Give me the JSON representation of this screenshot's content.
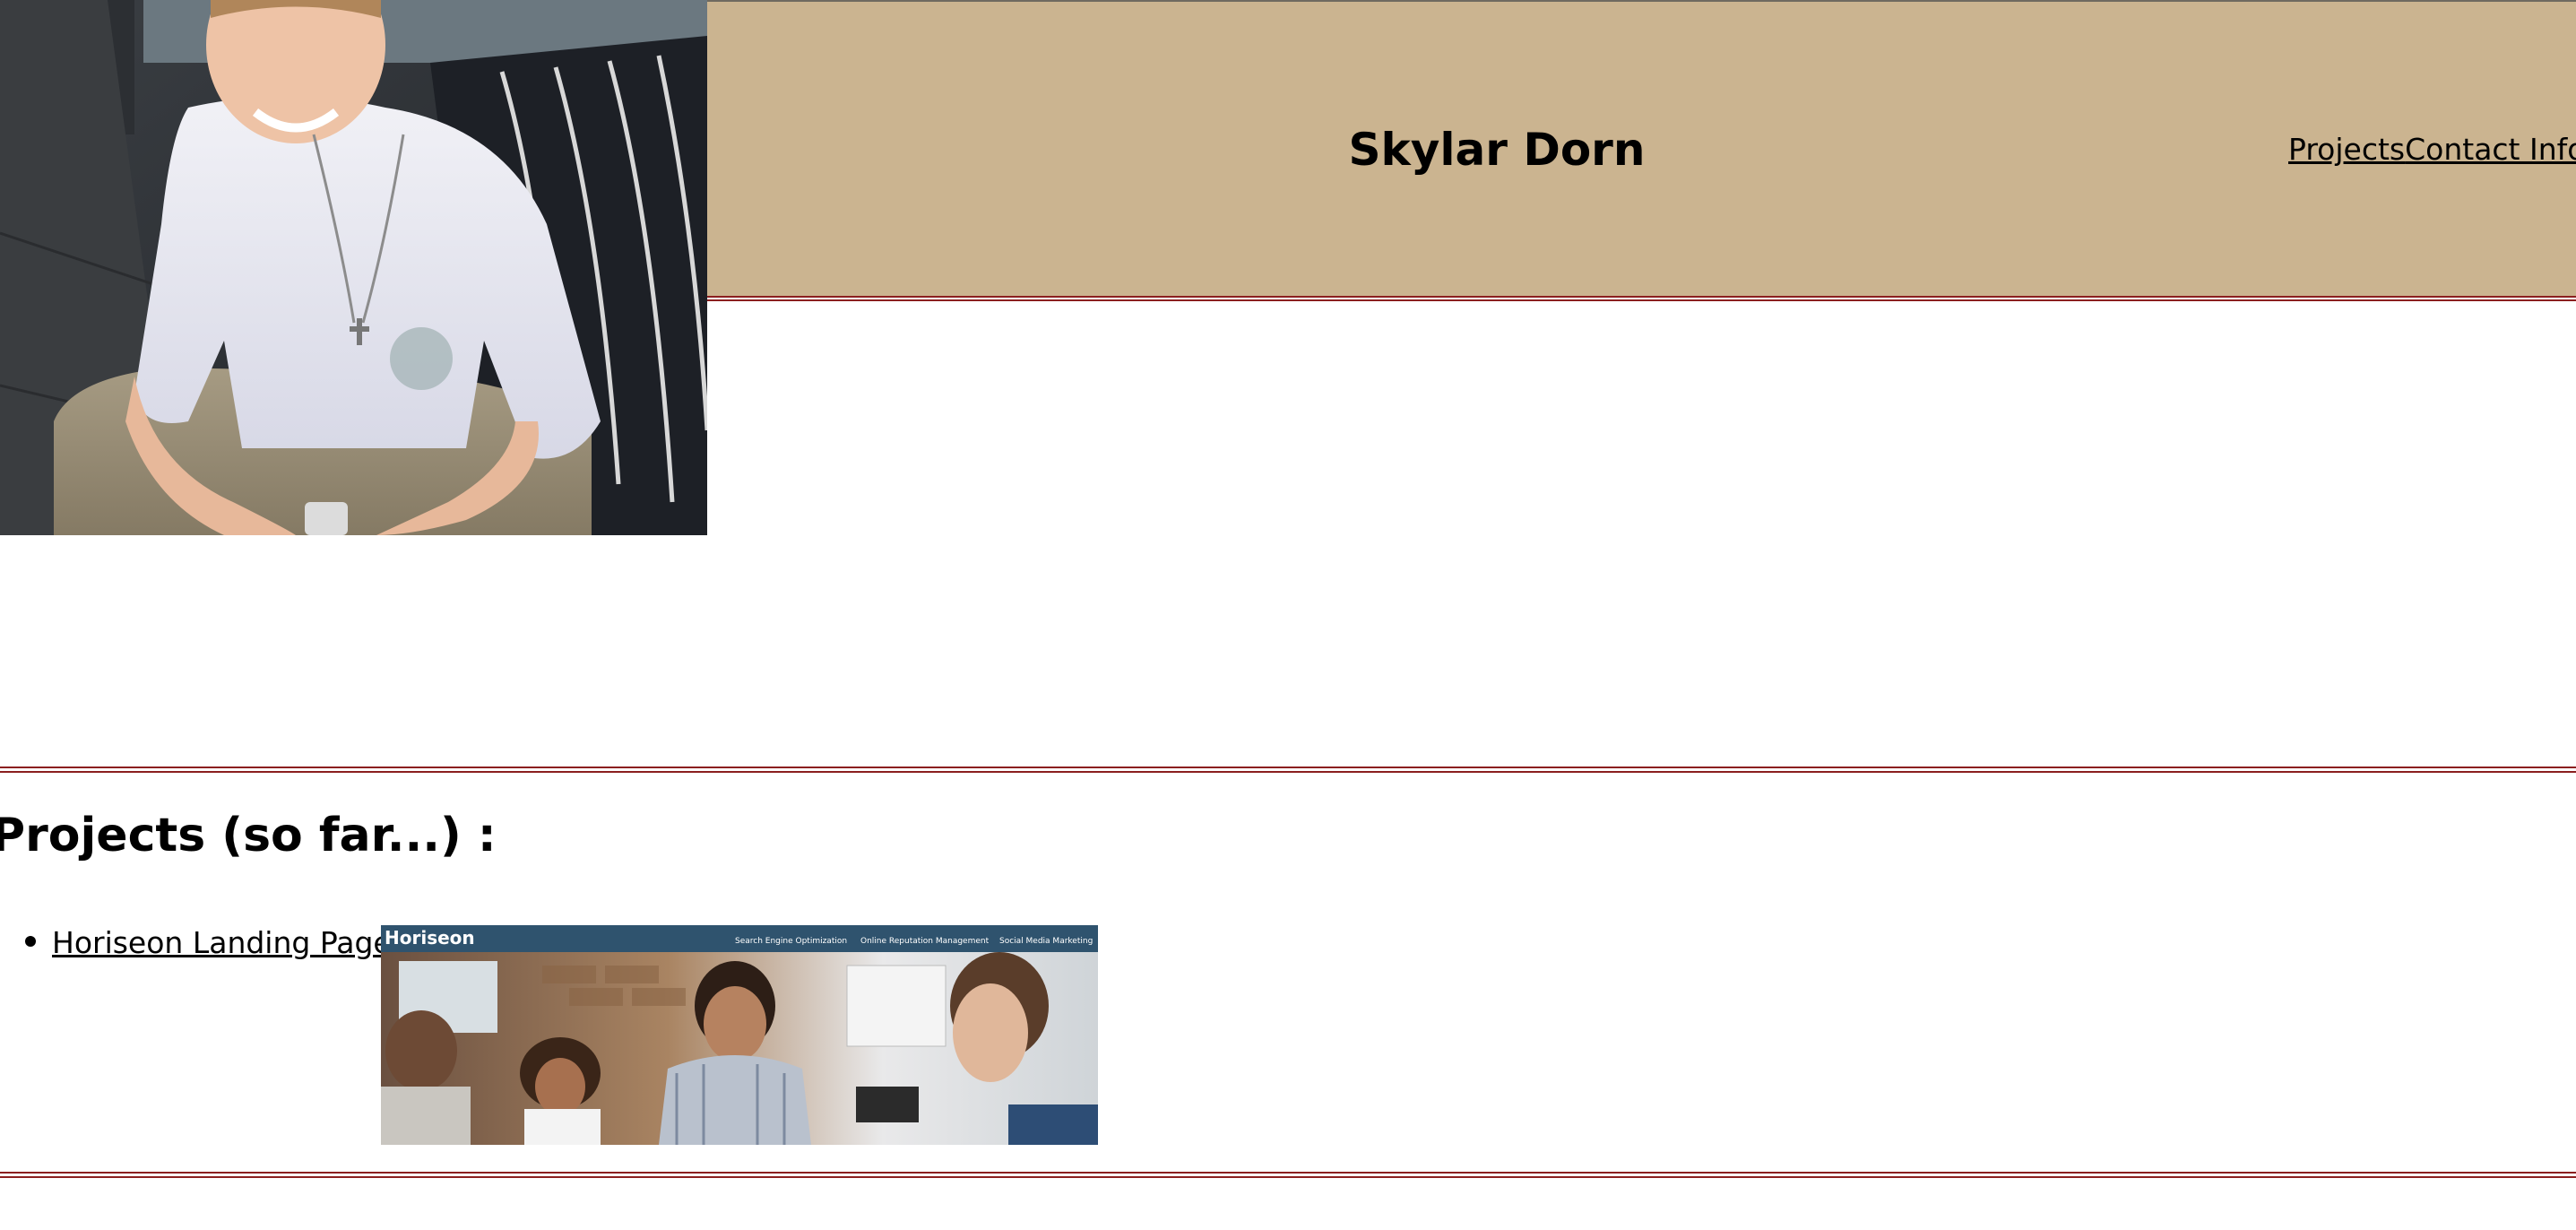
{
  "header": {
    "title": "Skylar Dorn",
    "nav": [
      {
        "label": "Projects"
      },
      {
        "label": "Contact Info"
      }
    ],
    "background_color": "#cbb490",
    "rule_color": "#8b1f1f"
  },
  "profile_photo": {
    "icon": "profile-photo"
  },
  "projects": {
    "heading": "Projects (so far...) :",
    "items": [
      {
        "label": "Horiseon Landing Page",
        "thumbnail": {
          "brand": "Horiseon",
          "nav": [
            "Search Engine Optimization",
            "Online Reputation Management",
            "Social Media Marketing"
          ]
        }
      }
    ]
  }
}
